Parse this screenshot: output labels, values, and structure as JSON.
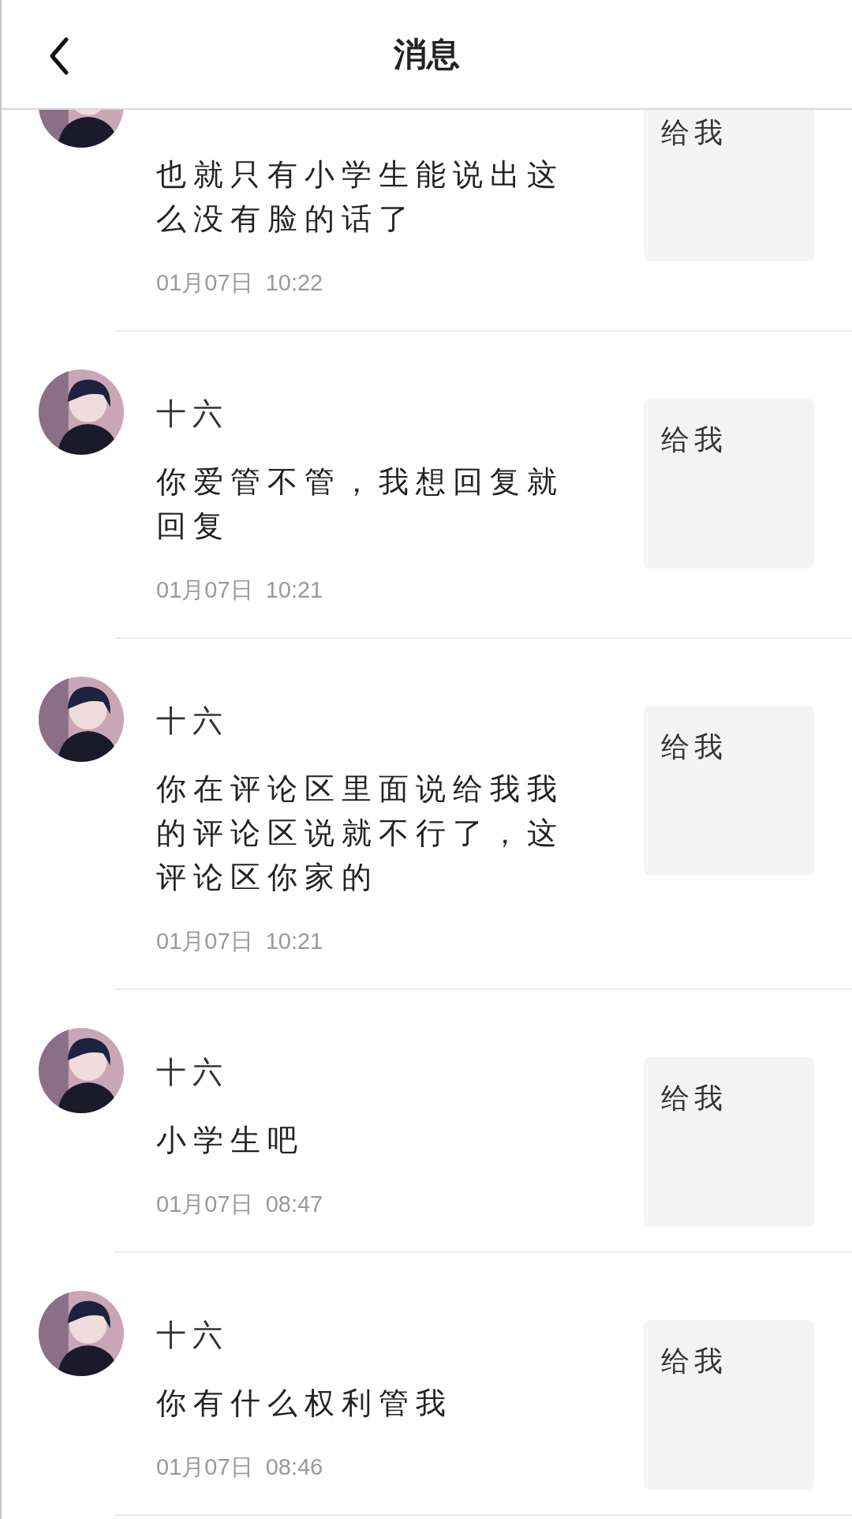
{
  "header": {
    "title": "消息"
  },
  "messages": [
    {
      "text": "也就只有小学生能说出这么没有脸的话了",
      "time": "01月07日  10:22",
      "quote": "给我"
    },
    {
      "name": "十六",
      "text": "你爱管不管，我想回复就回复",
      "time": "01月07日  10:21",
      "quote": "给我"
    },
    {
      "name": "十六",
      "text": "你在评论区里面说给我我的评论区说就不行了，这评论区你家的",
      "time": "01月07日  10:21",
      "quote": "给我"
    },
    {
      "name": "十六",
      "text": "小学生吧",
      "time": "01月07日  08:47",
      "quote": "给我"
    },
    {
      "name": "十六",
      "text": "你有什么权利管我",
      "time": "01月07日  08:46",
      "quote": "给我"
    }
  ]
}
